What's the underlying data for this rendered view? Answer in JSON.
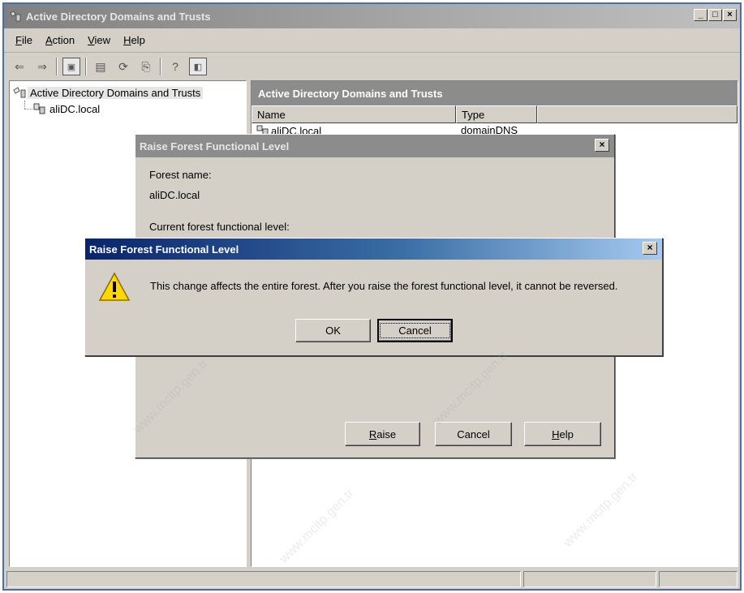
{
  "window": {
    "title": "Active Directory Domains and Trusts"
  },
  "menu": [
    {
      "label": "File",
      "key": "F",
      "rest": "ile"
    },
    {
      "label": "Action",
      "key": "A",
      "rest": "ction"
    },
    {
      "label": "View",
      "key": "V",
      "rest": "iew"
    },
    {
      "label": "Help",
      "key": "H",
      "rest": "elp"
    }
  ],
  "tree": {
    "root": "Active Directory Domains and Trusts",
    "child": "aliDC.local"
  },
  "right_pane": {
    "header": "Active Directory Domains and Trusts",
    "columns": [
      "Name",
      "Type"
    ],
    "rows": [
      {
        "name": "aliDC.local",
        "type": "domainDNS"
      }
    ]
  },
  "back_dialog": {
    "title": "Raise Forest Functional Level",
    "forest_name_label": "Forest name:",
    "forest_name_value": "aliDC.local",
    "current_level_label": "Current forest functional level:",
    "raise_key": "R",
    "raise_rest": "aise",
    "cancel": "Cancel",
    "help_key": "H",
    "help_rest": "elp"
  },
  "confirm_dialog": {
    "title": "Raise Forest Functional Level",
    "message": "This change affects the entire forest. After you raise the forest functional level, it cannot be reversed.",
    "ok": "OK",
    "cancel": "Cancel"
  },
  "watermark": {
    "text": "www.mcitp.gen.tr"
  },
  "colors": {
    "active_title_start": "#0a246a",
    "active_title_end": "#a6caf0",
    "inactive_title": "#8c8c8c",
    "face": "#d4d0c8"
  }
}
